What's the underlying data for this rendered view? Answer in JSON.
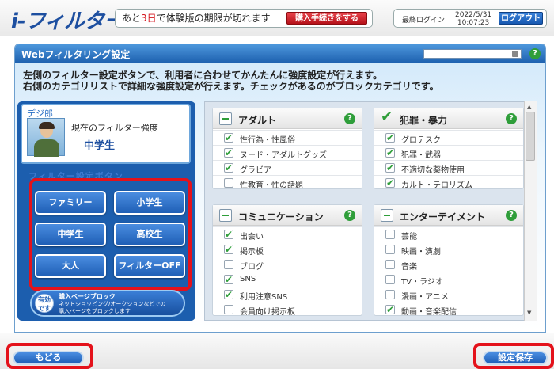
{
  "app": {
    "logo": "i-フィルター"
  },
  "trial": {
    "prefix": "あと",
    "days": "3日",
    "suffix": "で体験版の期限が切れます",
    "buy_label": "購入手続きをする"
  },
  "login": {
    "label": "最終ログイン",
    "date": "2022/5/31",
    "time": "10:07:23",
    "logout_label": "ログアウト"
  },
  "panel": {
    "title": "Webフィルタリング設定",
    "instructions": [
      "左側のフィルター設定ボタンで、利用者に合わせてかんたんに強度設定が行えます。",
      "右側のカテゴリリストで詳細な強度設定が行えます。チェックがあるのがブロックカテゴリです。"
    ]
  },
  "user": {
    "name": "デジ郎",
    "strength_label": "現在のフィルター強度",
    "strength_value": "中学生"
  },
  "filter_section_label": "フィルター設定ボタン",
  "filter_buttons": [
    "ファミリー",
    "小学生",
    "中学生",
    "高校生",
    "大人",
    "フィルターOFF"
  ],
  "promo": {
    "badge": [
      "有効",
      "です"
    ],
    "title": "購入ページブロック",
    "desc": [
      "ネットショッピング/オークションなどでの",
      "購入ページをブロックします"
    ]
  },
  "categories": [
    {
      "title": "アダルト",
      "head": "minus",
      "items": [
        {
          "label": "性行為・性風俗",
          "checked": true
        },
        {
          "label": "ヌード・アダルトグッズ",
          "checked": true
        },
        {
          "label": "グラビア",
          "checked": true
        },
        {
          "label": "性教育・性の話題",
          "checked": false
        }
      ]
    },
    {
      "title": "犯罪・暴力",
      "head": "check",
      "items": [
        {
          "label": "グロテスク",
          "checked": true
        },
        {
          "label": "犯罪・武器",
          "checked": true
        },
        {
          "label": "不適切な薬物使用",
          "checked": true
        },
        {
          "label": "カルト・テロリズム",
          "checked": true
        }
      ]
    },
    {
      "title": "コミュニケーション",
      "head": "minus",
      "items": [
        {
          "label": "出会い",
          "checked": true
        },
        {
          "label": "掲示板",
          "checked": true
        },
        {
          "label": "ブログ",
          "checked": false
        },
        {
          "label": "SNS",
          "checked": true
        },
        {
          "label": "利用注意SNS",
          "checked": true
        },
        {
          "label": "会員向け掲示板",
          "checked": false
        }
      ]
    },
    {
      "title": "エンターテイメント",
      "head": "minus",
      "items": [
        {
          "label": "芸能",
          "checked": false
        },
        {
          "label": "映画・演劇",
          "checked": false
        },
        {
          "label": "音楽",
          "checked": false
        },
        {
          "label": "TV・ラジオ",
          "checked": false
        },
        {
          "label": "漫画・アニメ",
          "checked": false
        },
        {
          "label": "動画・音楽配信",
          "checked": true
        }
      ]
    }
  ],
  "footer": {
    "back_label": "もどる",
    "save_label": "設定保存"
  },
  "colors": {
    "accent": "#1f5fb6",
    "highlight": "#e4121b",
    "check": "#2f9e3a"
  },
  "help_glyph": "?",
  "check_glyph": "✔"
}
